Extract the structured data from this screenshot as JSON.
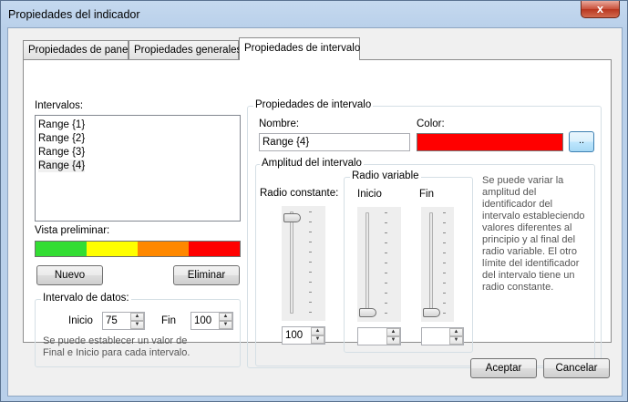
{
  "window": {
    "title": "Propiedades del indicador",
    "close_glyph": "x"
  },
  "tabs": [
    {
      "label": "Propiedades de panel"
    },
    {
      "label": "Propiedades generales"
    },
    {
      "label": "Propiedades de intervalo"
    }
  ],
  "intervals": {
    "label": "Intervalos:",
    "items": [
      "Range {1}",
      "Range {2}",
      "Range {3}",
      "Range {4}"
    ],
    "selected_index": 3
  },
  "preview": {
    "label": "Vista preliminar:",
    "colors": [
      "#33dd33",
      "#ffff00",
      "#ff8800",
      "#ff0000"
    ]
  },
  "buttons": {
    "new": "Nuevo",
    "delete": "Eliminar"
  },
  "data_interval": {
    "title": "Intervalo de datos:",
    "start_label": "Inicio",
    "start_value": "75",
    "end_label": "Fin",
    "end_value": "100",
    "note_line1": "Se puede establecer un valor de",
    "note_line2": "Final e Inicio para cada intervalo."
  },
  "interval_props": {
    "title": "Propiedades de intervalo",
    "name_label": "Nombre:",
    "name_value": "Range {4}",
    "color_label": "Color:",
    "color_value": "#ff0000",
    "color_button": ".."
  },
  "amplitude": {
    "title": "Amplitud del intervalo",
    "constant_label": "Radio constante:",
    "constant_value": "100",
    "variable_title": "Radio variable",
    "start_label": "Inicio",
    "end_label": "Fin",
    "start_value": "",
    "end_value": "",
    "note_lines": [
      "Se puede variar la",
      "amplitud del",
      "identificador del",
      "intervalo estableciendo",
      "valores diferentes al",
      "principio y al final del",
      "radio variable. El otro",
      "límite del identificador",
      "del intervalo tiene un",
      "radio constante."
    ]
  },
  "footer": {
    "accept": "Aceptar",
    "cancel": "Cancelar"
  }
}
